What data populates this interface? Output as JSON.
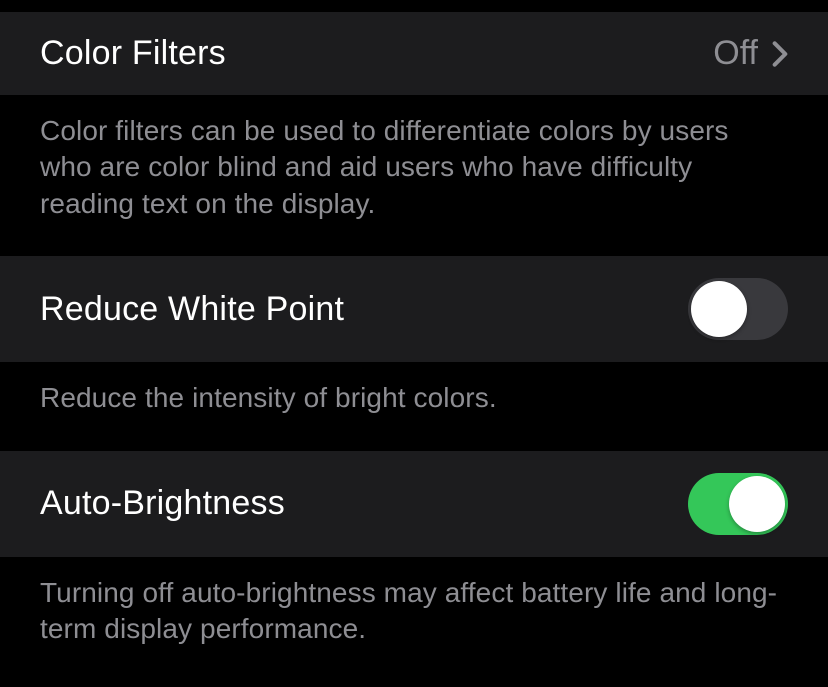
{
  "colorFilters": {
    "label": "Color Filters",
    "value": "Off",
    "footer": "Color filters can be used to differentiate colors by users who are color blind and aid users who have difficulty reading text on the display."
  },
  "reduceWhitePoint": {
    "label": "Reduce White Point",
    "enabled": false,
    "footer": "Reduce the intensity of bright colors."
  },
  "autoBrightness": {
    "label": "Auto-Brightness",
    "enabled": true,
    "footer": "Turning off auto-brightness may affect battery life and long-term display performance."
  }
}
